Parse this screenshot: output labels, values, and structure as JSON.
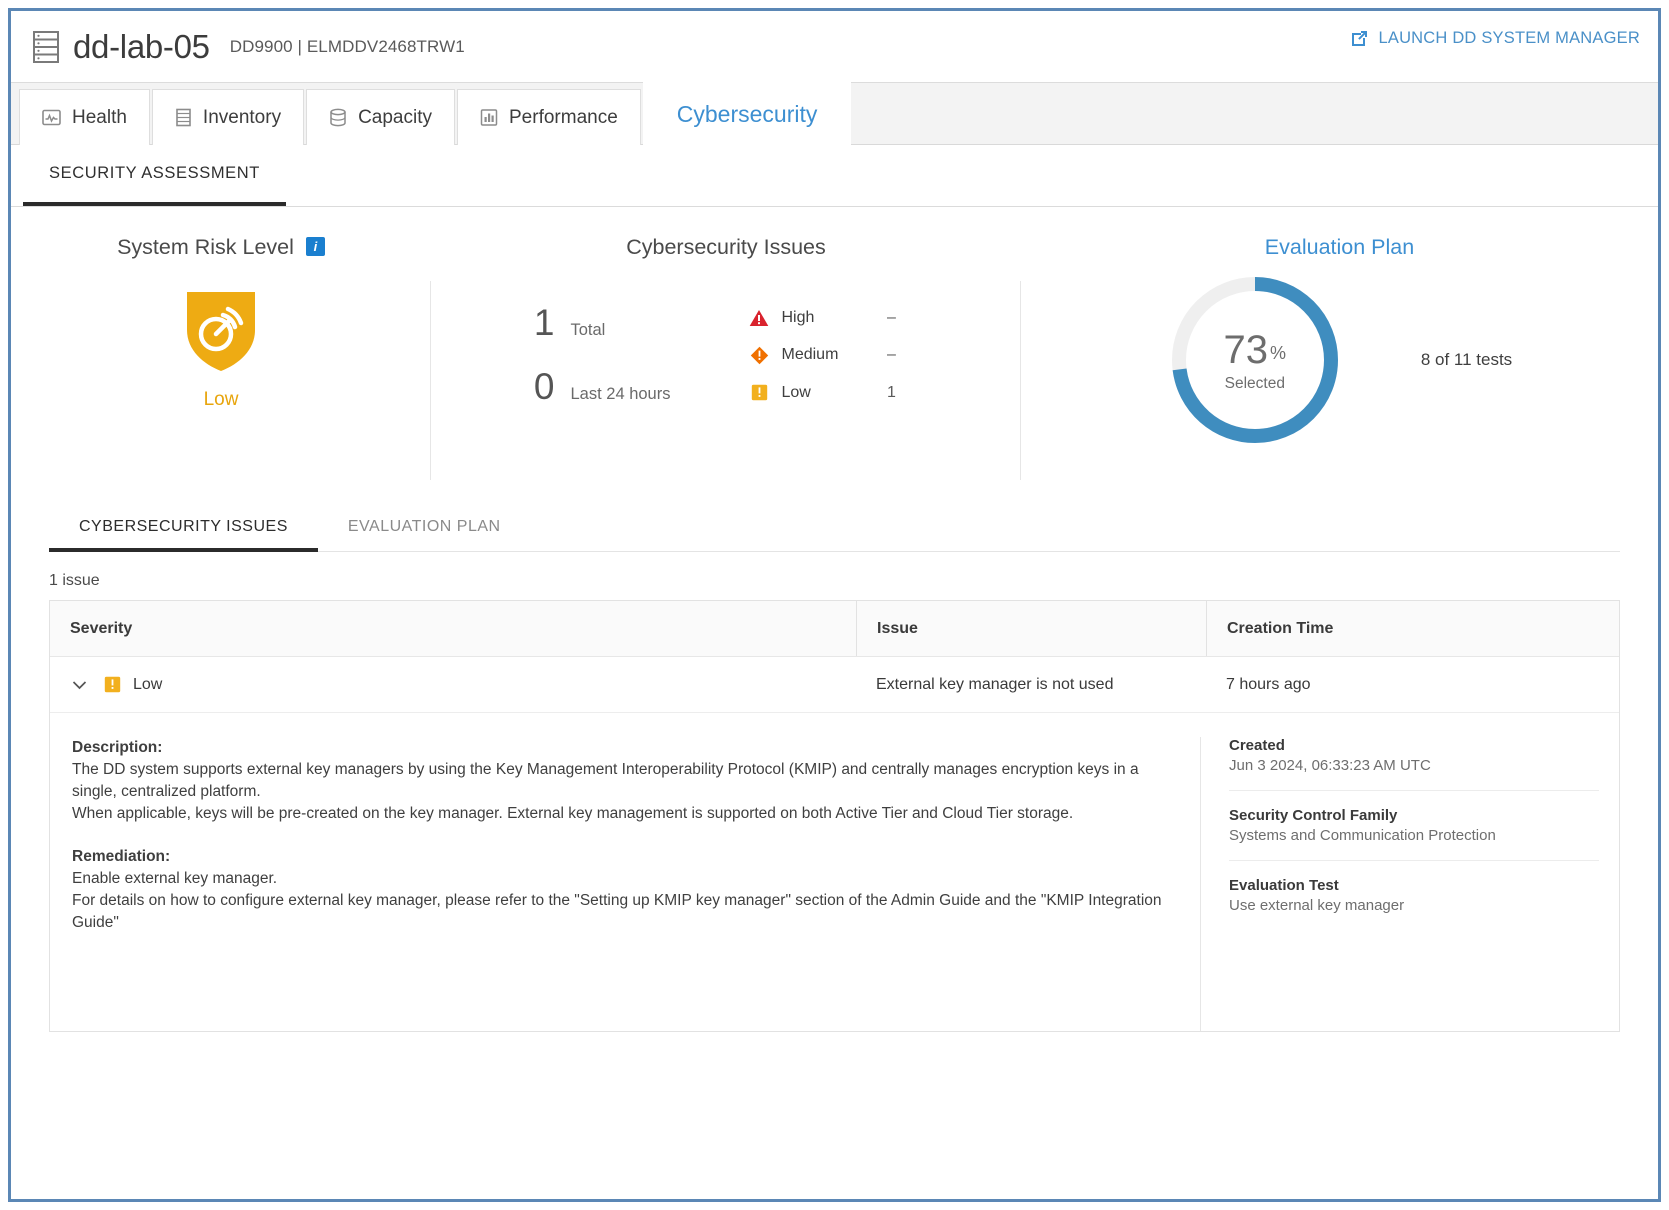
{
  "titlebar": {
    "icon": "server-rack-icon",
    "system_name": "dd-lab-05",
    "model_serial": "DD9900 | ELMDDV2468TRW1",
    "launch_label": "LAUNCH DD SYSTEM MANAGER",
    "launch_icon": "external-link-icon",
    "link_color": "#4a90c8"
  },
  "tabs": [
    {
      "label": "Health",
      "icon": "health-pulse-icon",
      "active": false
    },
    {
      "label": "Inventory",
      "icon": "inventory-list-icon",
      "active": false
    },
    {
      "label": "Capacity",
      "icon": "capacity-disk-icon",
      "active": false
    },
    {
      "label": "Performance",
      "icon": "performance-bars-icon",
      "active": false
    },
    {
      "label": "Cybersecurity",
      "icon": "",
      "active": true
    }
  ],
  "subnav": {
    "label": "SECURITY ASSESSMENT"
  },
  "summary": {
    "risk": {
      "title": "System Risk Level",
      "info_icon": "info-icon",
      "shield_icon": "shield-radar-icon",
      "level": "Low",
      "level_color": "#eeab13"
    },
    "issues": {
      "title": "Cybersecurity Issues",
      "counts": [
        {
          "value": "1",
          "label": "Total"
        },
        {
          "value": "0",
          "label": "Last 24 hours"
        }
      ],
      "severities": [
        {
          "icon": "severity-high-triangle-icon",
          "name": "High",
          "value": "–",
          "color": "#d9232e"
        },
        {
          "icon": "severity-medium-diamond-icon",
          "name": "Medium",
          "value": "–",
          "color": "#f07000"
        },
        {
          "icon": "severity-low-square-icon",
          "name": "Low",
          "value": "1",
          "color": "#f2b01e"
        }
      ]
    },
    "plan": {
      "title": "Evaluation Plan",
      "percent": "73",
      "percent_unit": "%",
      "sub_label": "Selected",
      "tests_text": "8 of 11 tests"
    }
  },
  "chart_data": {
    "type": "pie",
    "title": "Evaluation Plan",
    "categories": [
      "Selected",
      "Not selected"
    ],
    "values": [
      73,
      27
    ],
    "colors": [
      "#3f8dbf",
      "#efefef"
    ],
    "center_label": "73%",
    "center_sublabel": "Selected",
    "annotation": "8 of 11 tests",
    "legend": "none"
  },
  "lower_tabs": [
    {
      "label": "CYBERSECURITY ISSUES",
      "active": true
    },
    {
      "label": "EVALUATION PLAN",
      "active": false
    }
  ],
  "table": {
    "count_text": "1 issue",
    "columns": [
      "Severity",
      "Issue",
      "Creation Time"
    ],
    "rows": [
      {
        "chevron_icon": "chevron-down-icon",
        "severity_icon": "severity-low-square-icon",
        "severity": "Low",
        "issue": "External key manager is not used",
        "creation_time": "7 hours ago"
      }
    ]
  },
  "detail": {
    "description_label": "Description:",
    "description_line1": "The DD system supports external key managers by using the Key Management Interoperability Protocol (KMIP) and centrally manages encryption keys in a single, centralized platform.",
    "description_line2": "When applicable, keys will be pre-created on the key manager. External key management is supported on both Active Tier and Cloud Tier storage.",
    "remediation_label": "Remediation:",
    "remediation_line1": "Enable external key manager.",
    "remediation_line2": "For details on how to configure external key manager, please refer to the \"Setting up KMIP key manager\" section of the Admin Guide and the \"KMIP Integration Guide\"",
    "meta": [
      {
        "label": "Created",
        "value": "Jun 3 2024, 06:33:23 AM UTC"
      },
      {
        "label": "Security Control Family",
        "value": "Systems and Communication Protection"
      },
      {
        "label": "Evaluation Test",
        "value": "Use external key manager"
      }
    ]
  }
}
